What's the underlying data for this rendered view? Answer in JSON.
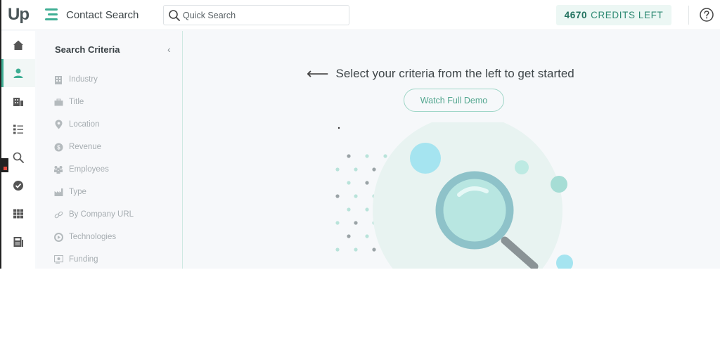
{
  "header": {
    "logo": "Up",
    "page_title": "Contact Search",
    "search_placeholder": "Quick Search",
    "credits_count": "4670",
    "credits_label": "CREDITS LEFT"
  },
  "nav": {
    "items": [
      {
        "icon": "home-icon",
        "active": false
      },
      {
        "icon": "contact-icon",
        "active": true
      },
      {
        "icon": "company-icon",
        "active": false
      },
      {
        "icon": "list-icon",
        "active": false
      },
      {
        "icon": "search-icon",
        "active": false
      },
      {
        "icon": "check-circle-icon",
        "active": false
      },
      {
        "icon": "grid-icon",
        "active": false
      },
      {
        "icon": "calculator-icon",
        "active": false
      }
    ]
  },
  "criteria": {
    "title": "Search Criteria",
    "collapse": "‹",
    "items": [
      {
        "label": "Industry",
        "icon": "building-icon"
      },
      {
        "label": "Title",
        "icon": "briefcase-icon"
      },
      {
        "label": "Location",
        "icon": "location-pin-icon"
      },
      {
        "label": "Revenue",
        "icon": "dollar-icon"
      },
      {
        "label": "Employees",
        "icon": "people-icon"
      },
      {
        "label": "Type",
        "icon": "factory-icon"
      },
      {
        "label": "By Company URL",
        "icon": "link-icon"
      },
      {
        "label": "Technologies",
        "icon": "gear-icon"
      },
      {
        "label": "Funding",
        "icon": "funding-icon"
      }
    ]
  },
  "main": {
    "arrow": "⟵",
    "instruction": "Select your criteria from the left to get started",
    "demo_button": "Watch Full Demo"
  },
  "colors": {
    "accent": "#3fae94",
    "credits_bg": "#ecf7f4",
    "text_dark": "#3c4447",
    "criteria_text": "#a6adb1"
  }
}
